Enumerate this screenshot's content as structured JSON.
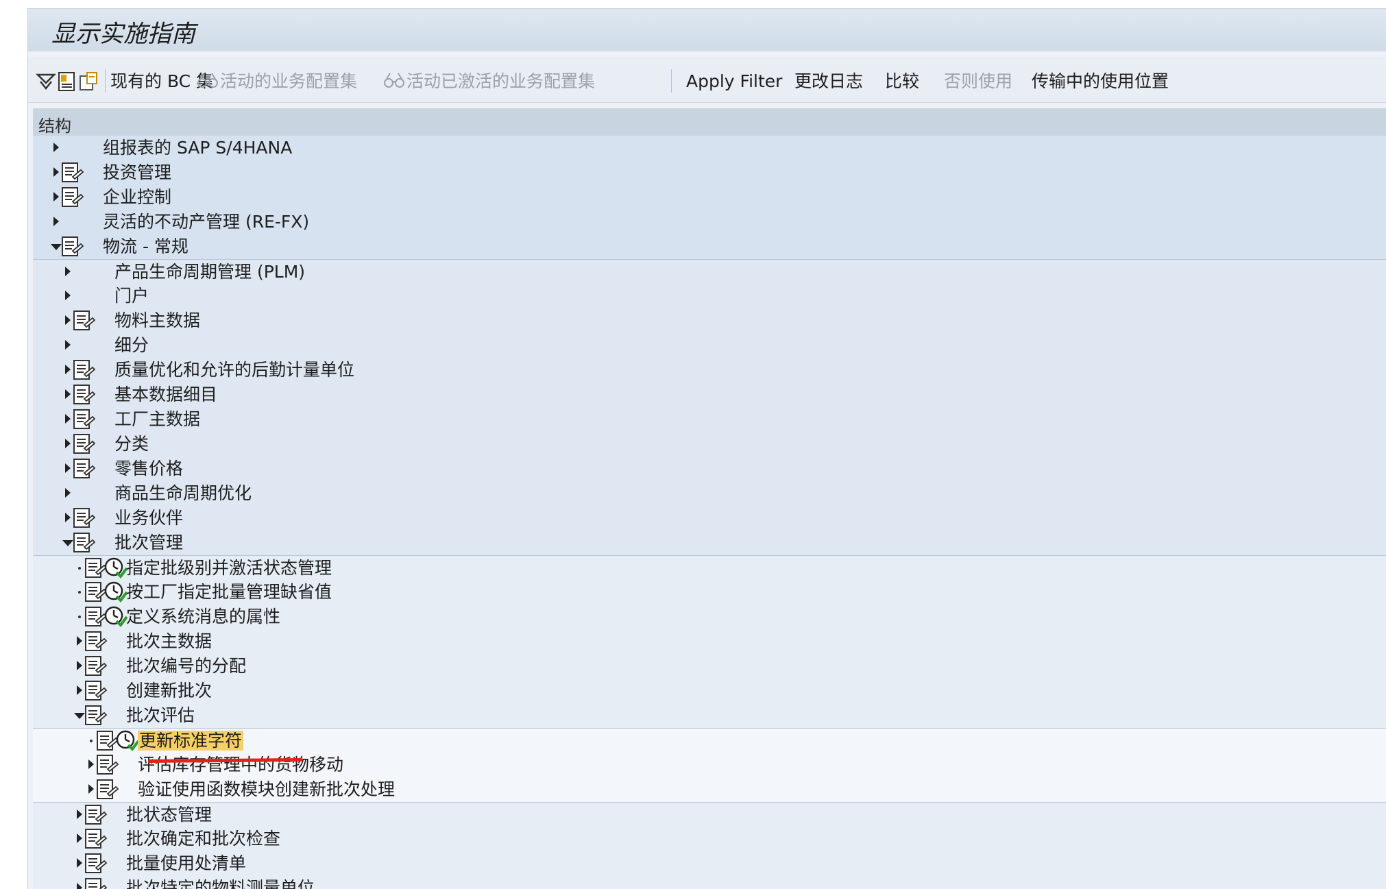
{
  "window": {
    "title": "显示实施指南"
  },
  "toolbar": {
    "icons": [
      "expand-subtree-icon",
      "img-icon",
      "clipboard-icon"
    ],
    "buttons": [
      {
        "label": "现有的 BC 集",
        "enabled": true
      },
      {
        "label": "活动的业务配置集",
        "enabled": false,
        "icon": "glasses-icon"
      },
      {
        "label": "活动已激活的业务配置集",
        "enabled": false,
        "icon": "glasses-icon"
      },
      {
        "label": "Apply Filter",
        "enabled": true
      },
      {
        "label": "更改日志",
        "enabled": true
      },
      {
        "label": "比较",
        "enabled": true
      },
      {
        "label": "否则使用",
        "enabled": false
      },
      {
        "label": "传输中的使用位置",
        "enabled": true
      }
    ]
  },
  "tree": {
    "header": "结构",
    "rows": [
      {
        "label": "组报表的 SAP S/4HANA",
        "level": 0,
        "state": "closed",
        "doc": false,
        "clock": false
      },
      {
        "label": "投资管理",
        "level": 0,
        "state": "closed",
        "doc": true,
        "clock": false
      },
      {
        "label": "企业控制",
        "level": 0,
        "state": "closed",
        "doc": true,
        "clock": false
      },
      {
        "label": "灵活的不动产管理 (RE-FX)",
        "level": 0,
        "state": "closed",
        "doc": false,
        "clock": false
      },
      {
        "label": "物流 - 常规",
        "level": 0,
        "state": "open",
        "doc": true,
        "clock": false
      },
      {
        "label": "产品生命周期管理 (PLM)",
        "level": 1,
        "state": "closed",
        "doc": false,
        "clock": false
      },
      {
        "label": "门户",
        "level": 1,
        "state": "closed",
        "doc": false,
        "clock": false
      },
      {
        "label": "物料主数据",
        "level": 1,
        "state": "closed",
        "doc": true,
        "clock": false
      },
      {
        "label": "细分",
        "level": 1,
        "state": "closed",
        "doc": false,
        "clock": false
      },
      {
        "label": "质量优化和允许的后勤计量单位",
        "level": 1,
        "state": "closed",
        "doc": true,
        "clock": false
      },
      {
        "label": "基本数据细目",
        "level": 1,
        "state": "closed",
        "doc": true,
        "clock": false
      },
      {
        "label": "工厂主数据",
        "level": 1,
        "state": "closed",
        "doc": true,
        "clock": false
      },
      {
        "label": "分类",
        "level": 1,
        "state": "closed",
        "doc": true,
        "clock": false
      },
      {
        "label": "零售价格",
        "level": 1,
        "state": "closed",
        "doc": true,
        "clock": false
      },
      {
        "label": "商品生命周期优化",
        "level": 1,
        "state": "closed",
        "doc": false,
        "clock": false
      },
      {
        "label": "业务伙伴",
        "level": 1,
        "state": "closed",
        "doc": true,
        "clock": false
      },
      {
        "label": "批次管理",
        "level": 1,
        "state": "open",
        "doc": true,
        "clock": false
      },
      {
        "label": "指定批级别并激活状态管理",
        "level": 2,
        "state": "leaf",
        "doc": true,
        "clock": true
      },
      {
        "label": "按工厂指定批量管理缺省值",
        "level": 2,
        "state": "leaf",
        "doc": true,
        "clock": true
      },
      {
        "label": "定义系统消息的属性",
        "level": 2,
        "state": "leaf",
        "doc": true,
        "clock": true
      },
      {
        "label": "批次主数据",
        "level": 2,
        "state": "closed",
        "doc": true,
        "clock": false
      },
      {
        "label": "批次编号的分配",
        "level": 2,
        "state": "closed",
        "doc": true,
        "clock": false
      },
      {
        "label": "创建新批次",
        "level": 2,
        "state": "closed",
        "doc": true,
        "clock": false
      },
      {
        "label": "批次评估",
        "level": 2,
        "state": "open",
        "doc": true,
        "clock": false
      },
      {
        "label": "更新标准字符",
        "level": 3,
        "state": "leaf",
        "doc": true,
        "clock": true,
        "selected": true
      },
      {
        "label": "评估库存管理中的货物移动",
        "level": 3,
        "state": "closed",
        "doc": true,
        "clock": false
      },
      {
        "label": "验证使用函数模块创建新批次处理",
        "level": 3,
        "state": "closed",
        "doc": true,
        "clock": false
      },
      {
        "label": "批状态管理",
        "level": 2,
        "state": "closed",
        "doc": true,
        "clock": false
      },
      {
        "label": "批次确定和批次检查",
        "level": 2,
        "state": "closed",
        "doc": true,
        "clock": false
      },
      {
        "label": "批量使用处清单",
        "level": 2,
        "state": "closed",
        "doc": true,
        "clock": false
      },
      {
        "label": "批次特定的物料测量单位",
        "level": 2,
        "state": "closed",
        "doc": true,
        "clock": false
      }
    ]
  },
  "colors": {
    "selection_highlight": "#f6cf67",
    "annotation_underline": "#e2231a"
  }
}
